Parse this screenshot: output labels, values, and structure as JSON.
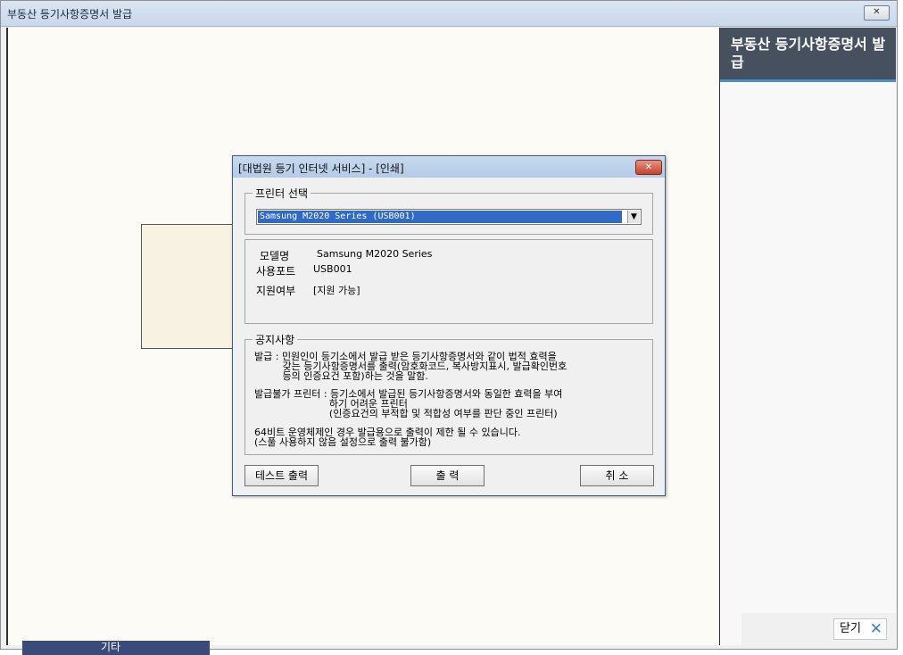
{
  "window": {
    "title": "부동산 등기사항증명서 발급",
    "close_glyph": "✕"
  },
  "side": {
    "header": "부동산 등기사항증명서 발급",
    "close_label": "닫기",
    "close_glyph": "✕"
  },
  "bottom_tab": {
    "label": "기타"
  },
  "dialog": {
    "title": "[대법원 등기 인터넷 서비스] - [인쇄]",
    "close_glyph": "✕",
    "printer_group_label": "프린터 선택",
    "printer_selected": "Samsung M2020 Series (USB001)",
    "dropdown_glyph": "▼",
    "info": {
      "model_label": "모델명",
      "model_value": "Samsung M2020 Series",
      "port_label": "사용포트",
      "port_value": "USB001",
      "support_label": "지원여부",
      "support_value": "[지원 가능]"
    },
    "notice": {
      "label": "공지사항",
      "lines": [
        "발급 : 민원인이 등기소에서 발급 받은 등기사항증명서와 같이 법적 효력을",
        "         갖는 등기사항증명서를 출력(암호화코드, 복사방지표시, 발급확인번호",
        "         등의 인증요건 포함)하는 것을 말함.",
        "발급불가 프린터 : 등기소에서 발급된 등기사항증명서와 동일한 효력을 부여",
        "                        하기 어려운 프린터",
        "                        (인증요건의 부적합 및 적합성 여부를 판단 중인 프린터)",
        "64비트 운영체제인 경우 발급용으로 출력이 제한 될 수 있습니다.",
        "(스풀 사용하지 않음 설정으로 출력 불가함)"
      ]
    },
    "buttons": {
      "test_print": "테스트 출력",
      "print": "출  력",
      "cancel": "취  소"
    }
  }
}
